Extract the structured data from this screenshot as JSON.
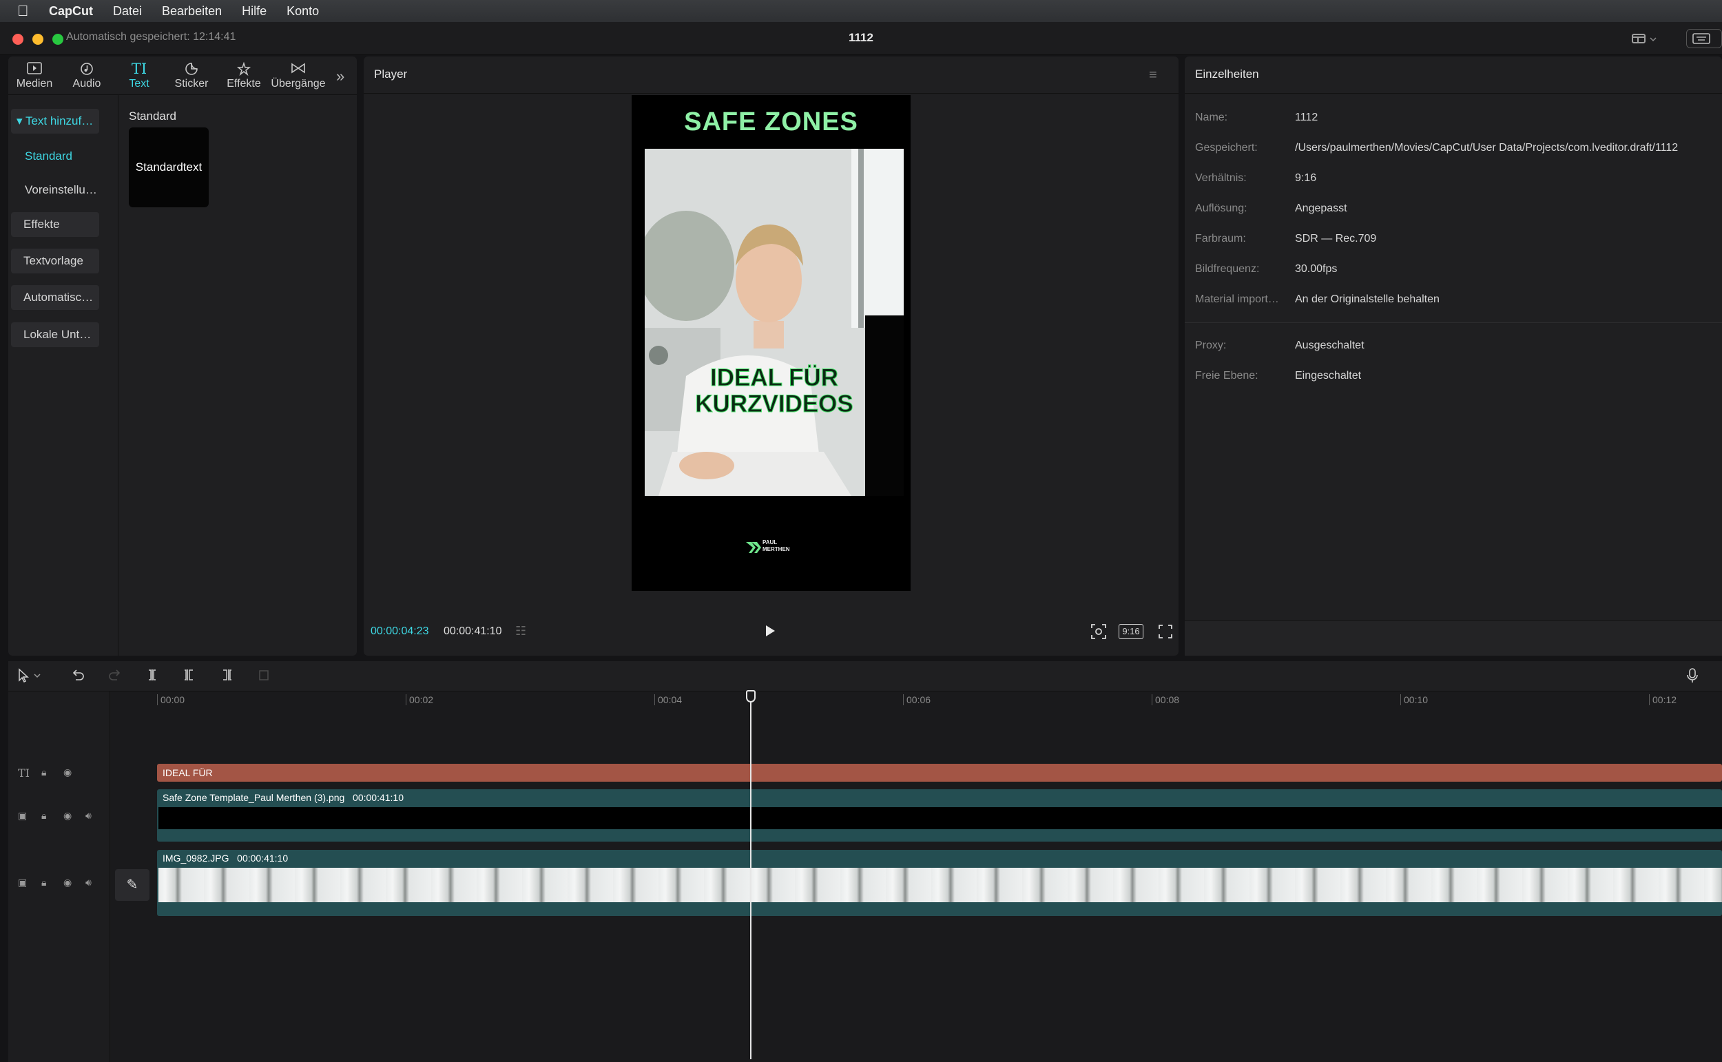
{
  "menubar": {
    "app": "CapCut",
    "items": [
      "Datei",
      "Bearbeiten",
      "Hilfe",
      "Konto"
    ]
  },
  "window": {
    "autosave": "Automatisch gespeichert: 12:14:41",
    "title": "1112"
  },
  "left_panel": {
    "tabs": [
      {
        "label": "Medien",
        "icon": "media-icon"
      },
      {
        "label": "Audio",
        "icon": "audio-icon"
      },
      {
        "label": "Text",
        "icon": "text-icon",
        "active": true
      },
      {
        "label": "Sticker",
        "icon": "sticker-icon"
      },
      {
        "label": "Effekte",
        "icon": "effects-icon"
      },
      {
        "label": "Übergänge",
        "icon": "transitions-icon"
      }
    ],
    "nav": {
      "text_add": "Text hinzuf…",
      "standard": "Standard",
      "presets": "Voreinstellu…",
      "effects": "Effekte",
      "template": "Textvorlage",
      "auto": "Automatisc…",
      "local": "Lokale Unt…"
    },
    "section_heading": "Standard",
    "card_label": "Standardtext"
  },
  "player": {
    "title": "Player",
    "preview": {
      "heading": "SAFE ZONES",
      "overlay_line1": "IDEAL FÜR",
      "overlay_line2": "KURZVIDEOS",
      "brand_line1": "PAUL",
      "brand_line2": "MERTHEN"
    },
    "time_current": "00:00:04:23",
    "time_total": "00:00:41:10",
    "ratio": "9:16"
  },
  "details": {
    "title": "Einzelheiten",
    "rows": [
      {
        "key": "Name:",
        "value": "1112"
      },
      {
        "key": "Gespeichert:",
        "value": "/Users/paulmerthen/Movies/CapCut/User Data/Projects/com.lveditor.draft/1112"
      },
      {
        "key": "Verhältnis:",
        "value": "9:16"
      },
      {
        "key": "Auflösung:",
        "value": "Angepasst"
      },
      {
        "key": "Farbraum:",
        "value": "SDR — Rec.709"
      },
      {
        "key": "Bildfrequenz:",
        "value": "30.00fps"
      },
      {
        "key": "Material import…",
        "value": "An der Originalstelle behalten"
      },
      {
        "key": "Proxy:",
        "value": "Ausgeschaltet"
      },
      {
        "key": "Freie Ebene:",
        "value": "Eingeschaltet"
      }
    ]
  },
  "timeline": {
    "ticks": [
      "00:00",
      "00:02",
      "00:04",
      "00:06",
      "00:08",
      "00:10",
      "00:12"
    ],
    "text_clip": "IDEAL FÜR",
    "overlay_clip": {
      "name": "Safe Zone Template_Paul Merthen (3).png",
      "duration": "00:00:41:10"
    },
    "main_clip": {
      "name": "IMG_0982.JPG",
      "duration": "00:00:41:10"
    }
  },
  "colors": {
    "accent": "#3ed7e3",
    "safe_title": "#8ff0a6",
    "text_clip": "#a35545",
    "video_clip": "#244e52"
  }
}
